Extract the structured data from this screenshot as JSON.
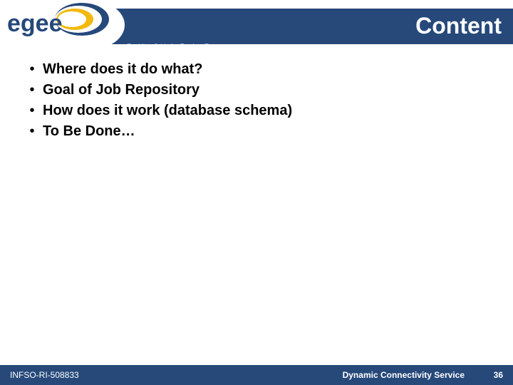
{
  "header": {
    "title": "Content",
    "tagline": "Enabling Grids for E-sciencE",
    "logo_text": "egee"
  },
  "bullets": [
    "Where does it do what?",
    "Goal of Job Repository",
    "How does it work (database schema)",
    "To Be Done…"
  ],
  "footer": {
    "left": "INFSO-RI-508833",
    "center": "Dynamic Connectivity Service",
    "page": "36"
  }
}
